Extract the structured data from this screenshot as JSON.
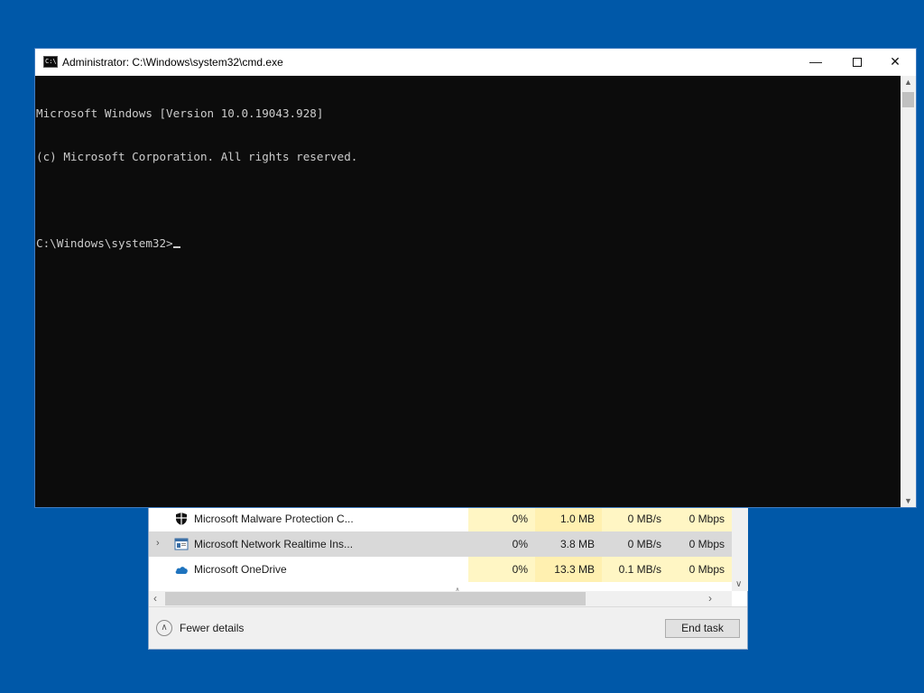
{
  "task_manager": {
    "processes": [
      {
        "name": "Microsoft Malware Protection C...",
        "icon": "shield-icon",
        "expandable": false,
        "cpu": "0%",
        "memory": "1.0 MB",
        "disk": "0 MB/s",
        "network": "0 Mbps"
      },
      {
        "name": "Microsoft Network Realtime Ins...",
        "icon": "app-window-icon",
        "expandable": true,
        "cpu": "0%",
        "memory": "3.8 MB",
        "disk": "0 MB/s",
        "network": "0 Mbps"
      },
      {
        "name": "Microsoft OneDrive",
        "icon": "onedrive-cloud-icon",
        "expandable": false,
        "cpu": "0%",
        "memory": "13.3 MB",
        "disk": "0.1 MB/s",
        "network": "0 Mbps"
      }
    ],
    "fewer_details_label": "Fewer details",
    "end_task_label": "End task",
    "colors": {
      "cell_highlight": "#fff6c4",
      "selected_row": "#d9d9d9"
    }
  },
  "cmd": {
    "title": "Administrator: C:\\Windows\\system32\\cmd.exe",
    "icon_text": "C:\\",
    "lines": [
      "Microsoft Windows [Version 10.0.19043.928]",
      "(c) Microsoft Corporation. All rights reserved.",
      "",
      "C:\\Windows\\system32>"
    ],
    "colors": {
      "background": "#0c0c0c",
      "text": "#cccccc"
    }
  },
  "desktop": {
    "background": "#0058a8"
  }
}
